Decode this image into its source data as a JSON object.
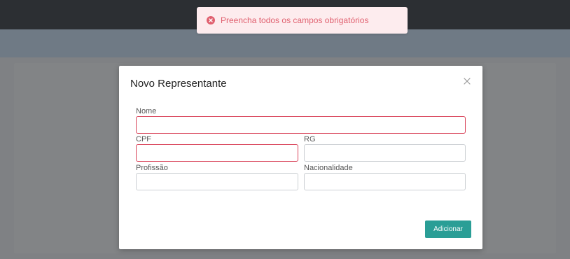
{
  "toast": {
    "message": "Preencha todos os campos obrigatórios",
    "icon": "error-circle-icon",
    "color": "#e0606f"
  },
  "modal": {
    "title": "Novo Representante",
    "close_icon": "close-icon",
    "fields": {
      "nome": {
        "label": "Nome",
        "value": "",
        "error": true
      },
      "cpf": {
        "label": "CPF",
        "value": "",
        "error": true
      },
      "rg": {
        "label": "RG",
        "value": "",
        "error": false
      },
      "profissao": {
        "label": "Profissão",
        "value": "",
        "error": false
      },
      "nacionalidade": {
        "label": "Nacionalidade",
        "value": "",
        "error": false
      }
    },
    "submit_label": "Adicionar"
  },
  "colors": {
    "accent": "#2a9e96",
    "error": "#d9445a"
  }
}
